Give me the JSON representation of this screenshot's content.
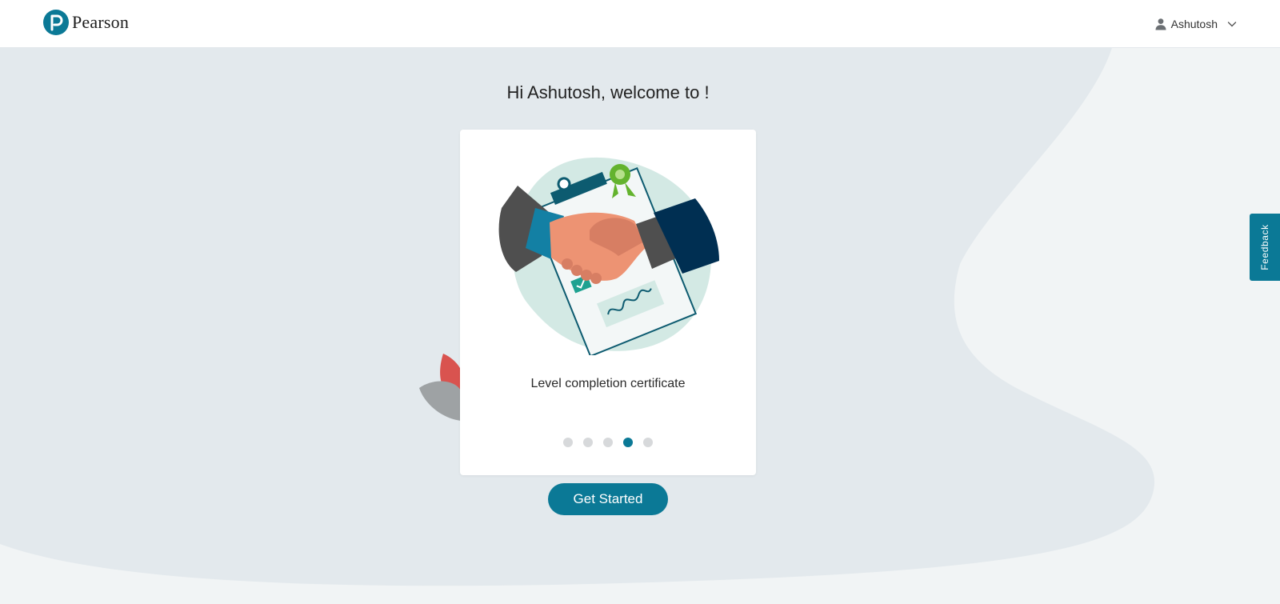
{
  "header": {
    "brand": "Pearson",
    "user_name": "Ashutosh"
  },
  "main": {
    "welcome_text": "Hi Ashutosh, welcome to !",
    "carousel": {
      "slide_caption": "Level completion certificate",
      "slide_count": 5,
      "active_index": 3
    },
    "get_started_label": "Get Started"
  },
  "feedback_label": "Feedback",
  "icons": {
    "logo": "pearson-logo-icon",
    "user": "user-icon",
    "dropdown": "chevron-down-icon"
  },
  "colors": {
    "accent": "#0b7996",
    "page_background": "#f1f4f5",
    "wave_background": "#e3e9ed",
    "card_background": "#ffffff",
    "dot_inactive": "#d7d9db"
  }
}
